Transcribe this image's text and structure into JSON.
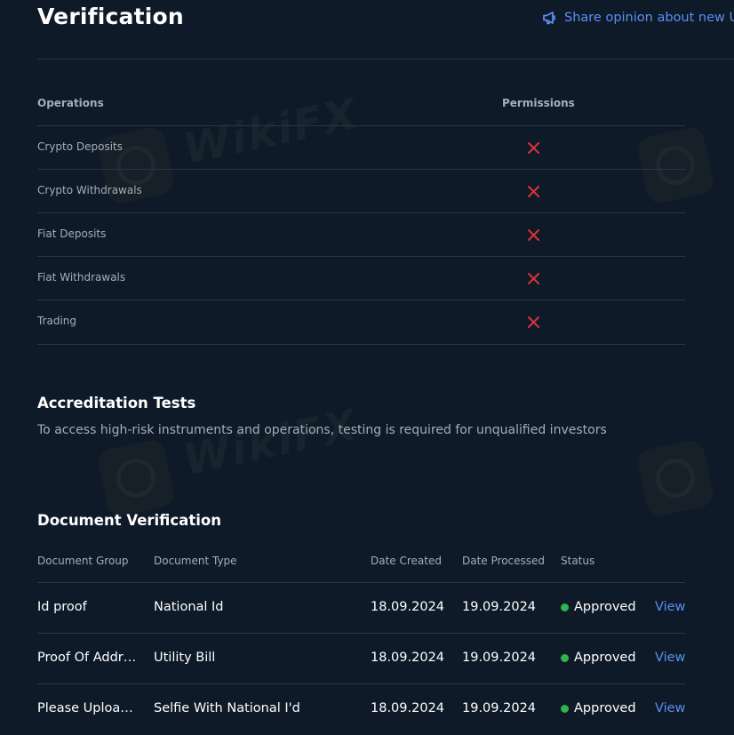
{
  "header": {
    "title": "Verification",
    "share_label": "Share opinion about new UI",
    "share_icon": "megaphone-icon"
  },
  "permissions": {
    "headers": {
      "operations": "Operations",
      "permissions": "Permissions"
    },
    "rows": [
      {
        "label": "Crypto Deposits",
        "allowed": false
      },
      {
        "label": "Crypto Withdrawals",
        "allowed": false
      },
      {
        "label": "Fiat Deposits",
        "allowed": false
      },
      {
        "label": "Fiat Withdrawals",
        "allowed": false
      },
      {
        "label": "Trading",
        "allowed": false
      }
    ],
    "denied_icon": "x-icon",
    "denied_color": "#d9323a"
  },
  "accreditation": {
    "title": "Accreditation Tests",
    "description": "To access high-risk instruments and operations, testing is required for unqualified investors"
  },
  "documents": {
    "title": "Document Verification",
    "headers": {
      "group": "Document Group",
      "type": "Document Type",
      "created": "Date Created",
      "processed": "Date Processed",
      "status": "Status"
    },
    "rows": [
      {
        "group": "Id proof",
        "type": "National Id",
        "created": "18.09.2024",
        "processed": "19.09.2024",
        "status": "Approved",
        "action": "View"
      },
      {
        "group": "Proof Of Addr…",
        "type": "Utility Bill",
        "created": "18.09.2024",
        "processed": "19.09.2024",
        "status": "Approved",
        "action": "View"
      },
      {
        "group": "Please Uploa…",
        "type": "Selfie With National I'd",
        "created": "18.09.2024",
        "processed": "19.09.2024",
        "status": "Approved",
        "action": "View"
      }
    ],
    "status_color": "#2fb34a"
  },
  "watermark": {
    "text": "WikiFX"
  },
  "colors": {
    "background": "#0f1a28",
    "accent": "#5b8ef2",
    "muted_text": "#a5adb8",
    "divider": "#2a3645"
  }
}
